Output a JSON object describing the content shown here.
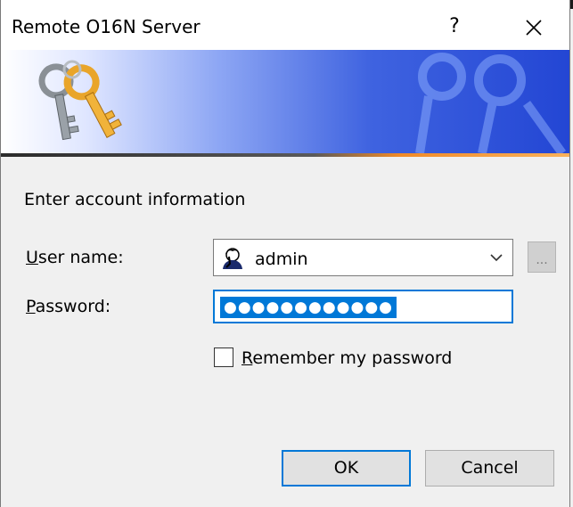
{
  "window": {
    "title": "Remote O16N Server",
    "help_label": "?",
    "close_icon": "close-icon"
  },
  "banner": {
    "icon": "keys-icon",
    "watermark_icon": "keys-watermark-icon"
  },
  "form": {
    "section_label": "Enter account information",
    "user_label_accel": "U",
    "user_label_rest": "ser name:",
    "password_label_accel": "P",
    "password_label_rest": "assword:",
    "username_value": "admin",
    "user_icon": "user-icon",
    "dropdown_icon": "chevron-down-icon",
    "browse_label": "...",
    "password_masked": "●●●●●●●●●●●●",
    "remember_accel": "R",
    "remember_rest": "emember my password",
    "remember_checked": false
  },
  "buttons": {
    "ok_label": "OK",
    "cancel_label": "Cancel"
  },
  "colors": {
    "accent": "#0078d7",
    "banner_dark": "#2346d4",
    "banner_accent": "#f08a28"
  }
}
